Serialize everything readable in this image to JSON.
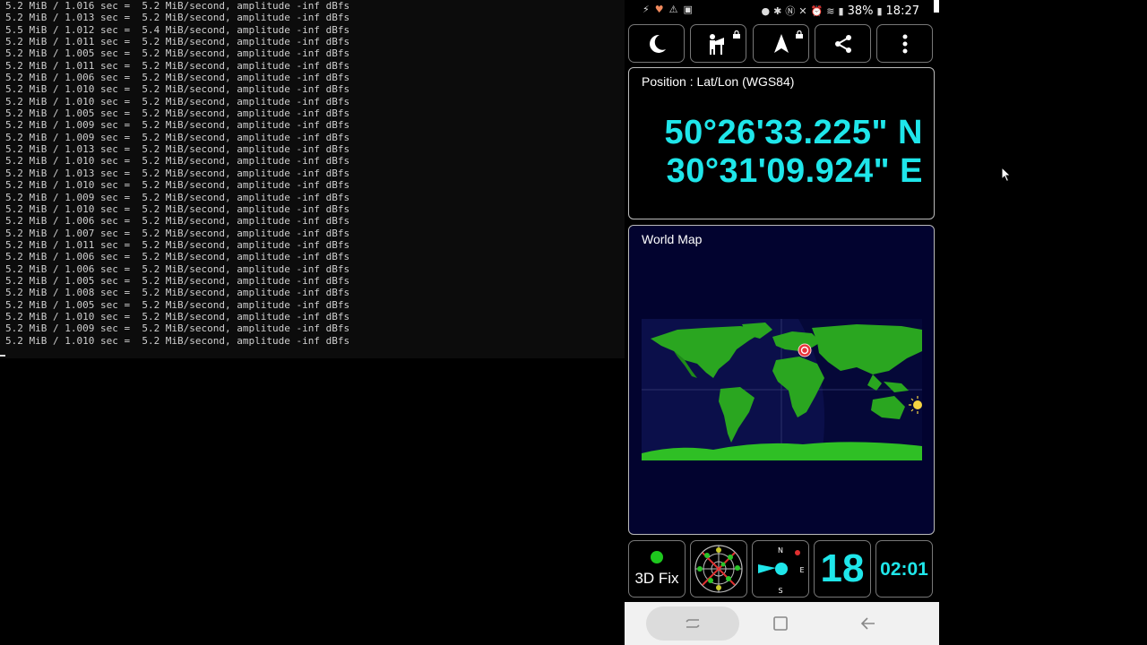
{
  "terminal": {
    "lines": [
      "5.2 MiB / 1.016 sec =  5.2 MiB/second, amplitude -inf dBfs",
      "5.2 MiB / 1.013 sec =  5.2 MiB/second, amplitude -inf dBfs",
      "5.5 MiB / 1.012 sec =  5.4 MiB/second, amplitude -inf dBfs",
      "5.2 MiB / 1.011 sec =  5.2 MiB/second, amplitude -inf dBfs",
      "5.2 MiB / 1.005 sec =  5.2 MiB/second, amplitude -inf dBfs",
      "5.2 MiB / 1.011 sec =  5.2 MiB/second, amplitude -inf dBfs",
      "5.2 MiB / 1.006 sec =  5.2 MiB/second, amplitude -inf dBfs",
      "5.2 MiB / 1.010 sec =  5.2 MiB/second, amplitude -inf dBfs",
      "5.2 MiB / 1.010 sec =  5.2 MiB/second, amplitude -inf dBfs",
      "5.2 MiB / 1.005 sec =  5.2 MiB/second, amplitude -inf dBfs",
      "5.2 MiB / 1.009 sec =  5.2 MiB/second, amplitude -inf dBfs",
      "5.2 MiB / 1.009 sec =  5.2 MiB/second, amplitude -inf dBfs",
      "5.2 MiB / 1.013 sec =  5.2 MiB/second, amplitude -inf dBfs",
      "5.2 MiB / 1.010 sec =  5.2 MiB/second, amplitude -inf dBfs",
      "5.2 MiB / 1.013 sec =  5.2 MiB/second, amplitude -inf dBfs",
      "5.2 MiB / 1.010 sec =  5.2 MiB/second, amplitude -inf dBfs",
      "5.2 MiB / 1.009 sec =  5.2 MiB/second, amplitude -inf dBfs",
      "5.2 MiB / 1.010 sec =  5.2 MiB/second, amplitude -inf dBfs",
      "5.2 MiB / 1.006 sec =  5.2 MiB/second, amplitude -inf dBfs",
      "5.2 MiB / 1.007 sec =  5.2 MiB/second, amplitude -inf dBfs",
      "5.2 MiB / 1.011 sec =  5.2 MiB/second, amplitude -inf dBfs",
      "5.2 MiB / 1.006 sec =  5.2 MiB/second, amplitude -inf dBfs",
      "5.2 MiB / 1.006 sec =  5.2 MiB/second, amplitude -inf dBfs",
      "5.2 MiB / 1.005 sec =  5.2 MiB/second, amplitude -inf dBfs",
      "5.2 MiB / 1.008 sec =  5.2 MiB/second, amplitude -inf dBfs",
      "5.2 MiB / 1.005 sec =  5.2 MiB/second, amplitude -inf dBfs",
      "5.2 MiB / 1.010 sec =  5.2 MiB/second, amplitude -inf dBfs",
      "5.2 MiB / 1.009 sec =  5.2 MiB/second, amplitude -inf dBfs",
      "5.2 MiB / 1.010 sec =  5.2 MiB/second, amplitude -inf dBfs"
    ]
  },
  "status_bar": {
    "battery": "38%",
    "time": "18:27",
    "icons": [
      "usb-icon",
      "heart-icon",
      "warning-icon",
      "image-icon",
      "location-icon",
      "bluetooth-icon",
      "nfc-icon",
      "mute-icon",
      "alarm-icon",
      "wifi-icon",
      "signal-icon",
      "battery-icon"
    ]
  },
  "toolbar": {
    "buttons": [
      "night-mode-icon",
      "people-lock-icon",
      "navigation-arrow-lock-icon",
      "share-icon",
      "more-vert-icon"
    ]
  },
  "position": {
    "title": "Position : Lat/Lon (WGS84)",
    "lat": "50°26'33.225\" N",
    "lon": "30°31'09.924\" E"
  },
  "world_map": {
    "title": "World Map",
    "land_color": "#26a81c",
    "ocean_color": "#0b0f4a",
    "marker_color": "#e8333a"
  },
  "bottom_tiles": {
    "fix_label": "3D Fix",
    "fix_color": "#1ec81e",
    "compass_n": "N",
    "compass_s": "S",
    "compass_e": "E",
    "satellites": "18",
    "time": "02:01"
  },
  "colors": {
    "accent": "#1fe6ea",
    "panel_border": "#bbbbbb"
  }
}
